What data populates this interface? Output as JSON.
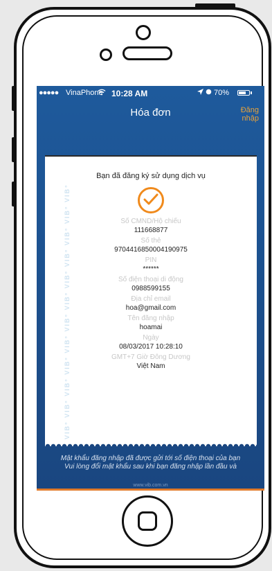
{
  "status_bar": {
    "signal": "●●●●●",
    "carrier": "VinaPhone",
    "wifi_icon": "wifi-icon",
    "time": "10:28 AM",
    "location_icon": "location-icon",
    "alarm_icon": "alarm-icon",
    "battery_percent": "70%",
    "battery_level": 0.7
  },
  "nav": {
    "title": "Hóa đơn",
    "login_line1": "Đăng",
    "login_line2": "nhập"
  },
  "receipt": {
    "watermark_text": "VIB° VIB° VIB° VIB° VIB° VIB° VIB° VIB° VIB° VIB° VIB° VIB°",
    "heading": "Bạn đã đăng ký sử dụng dịch vụ",
    "fields": [
      {
        "label": "Số CMND/Hộ chiếu",
        "value": "111668877"
      },
      {
        "label": "Số thẻ",
        "value": "9704416850004190975"
      },
      {
        "label": "PIN",
        "value": "******"
      },
      {
        "label": "Số điện thoại di động",
        "value": "0988599155"
      },
      {
        "label": "Địa chỉ email",
        "value": "hoa@gmail.com"
      },
      {
        "label": "Tên đăng nhập",
        "value": "hoamai"
      },
      {
        "label": "Ngày",
        "value": "08/03/2017 10:28:10"
      },
      {
        "label": "GMT+7 Giờ Đông Dương",
        "value": "Việt Nam"
      }
    ]
  },
  "footer": {
    "note_line1": "Mật khẩu đăng nhập đã được gửi tới số điện thoại của bạn",
    "note_line2": "Vui lòng đổi mật khẩu sau khi bạn đăng nhập lần đầu và",
    "url": "www.vib.com.vn"
  },
  "colors": {
    "screen_blue": "#1c4f8c",
    "accent_orange": "#f08a1c"
  }
}
